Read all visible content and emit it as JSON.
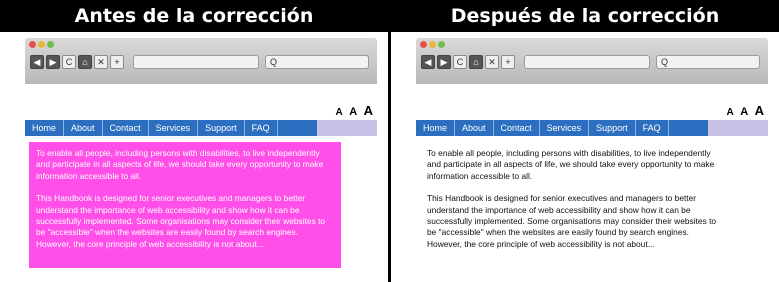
{
  "panels": [
    {
      "heading": "Antes de la corrección",
      "search_placeholder": "Q",
      "text_size": [
        "A",
        "A",
        "A"
      ],
      "nav": [
        "Home",
        "About",
        "Contact",
        "Services",
        "Support",
        "FAQ"
      ],
      "paragraphs": [
        "To enable all people, including persons with disabilities, to live independently and participate in all aspects of life, we should take every opportunity to make information accessible to all.",
        "This Handbook is designed for senior executives and managers to better understand the importance of web accessibility and show how it can be successfully implemented. Some organisations may consider their websites to be \"accessible\" when the websites are easily found by search engines. However, the core principle of web accessibility is not about..."
      ]
    },
    {
      "heading": "Después de la corrección",
      "search_placeholder": "Q",
      "text_size": [
        "A",
        "A",
        "A"
      ],
      "nav": [
        "Home",
        "About",
        "Contact",
        "Services",
        "Support",
        "FAQ"
      ],
      "paragraphs": [
        "To enable all people, including persons with disabilities, to live independently and participate in all aspects of life, we should take every opportunity to make information accessible to all.",
        "This Handbook is designed for senior executives and managers to better understand the importance of web accessibility and show how it can be successfully implemented. Some organisations may consider their websites to be \"accessible\" when the websites are easily found by search engines. However, the core principle of web accessibility is not about..."
      ]
    }
  ],
  "browser_buttons": [
    "◀",
    "▶",
    "C",
    "⌂",
    "✕",
    "+"
  ],
  "colors": {
    "before_background": "#ff4fe8",
    "before_text": "#ffffff",
    "after_background": "#ffffff",
    "after_text": "#111111",
    "nav_background": "#2c6fc0"
  }
}
